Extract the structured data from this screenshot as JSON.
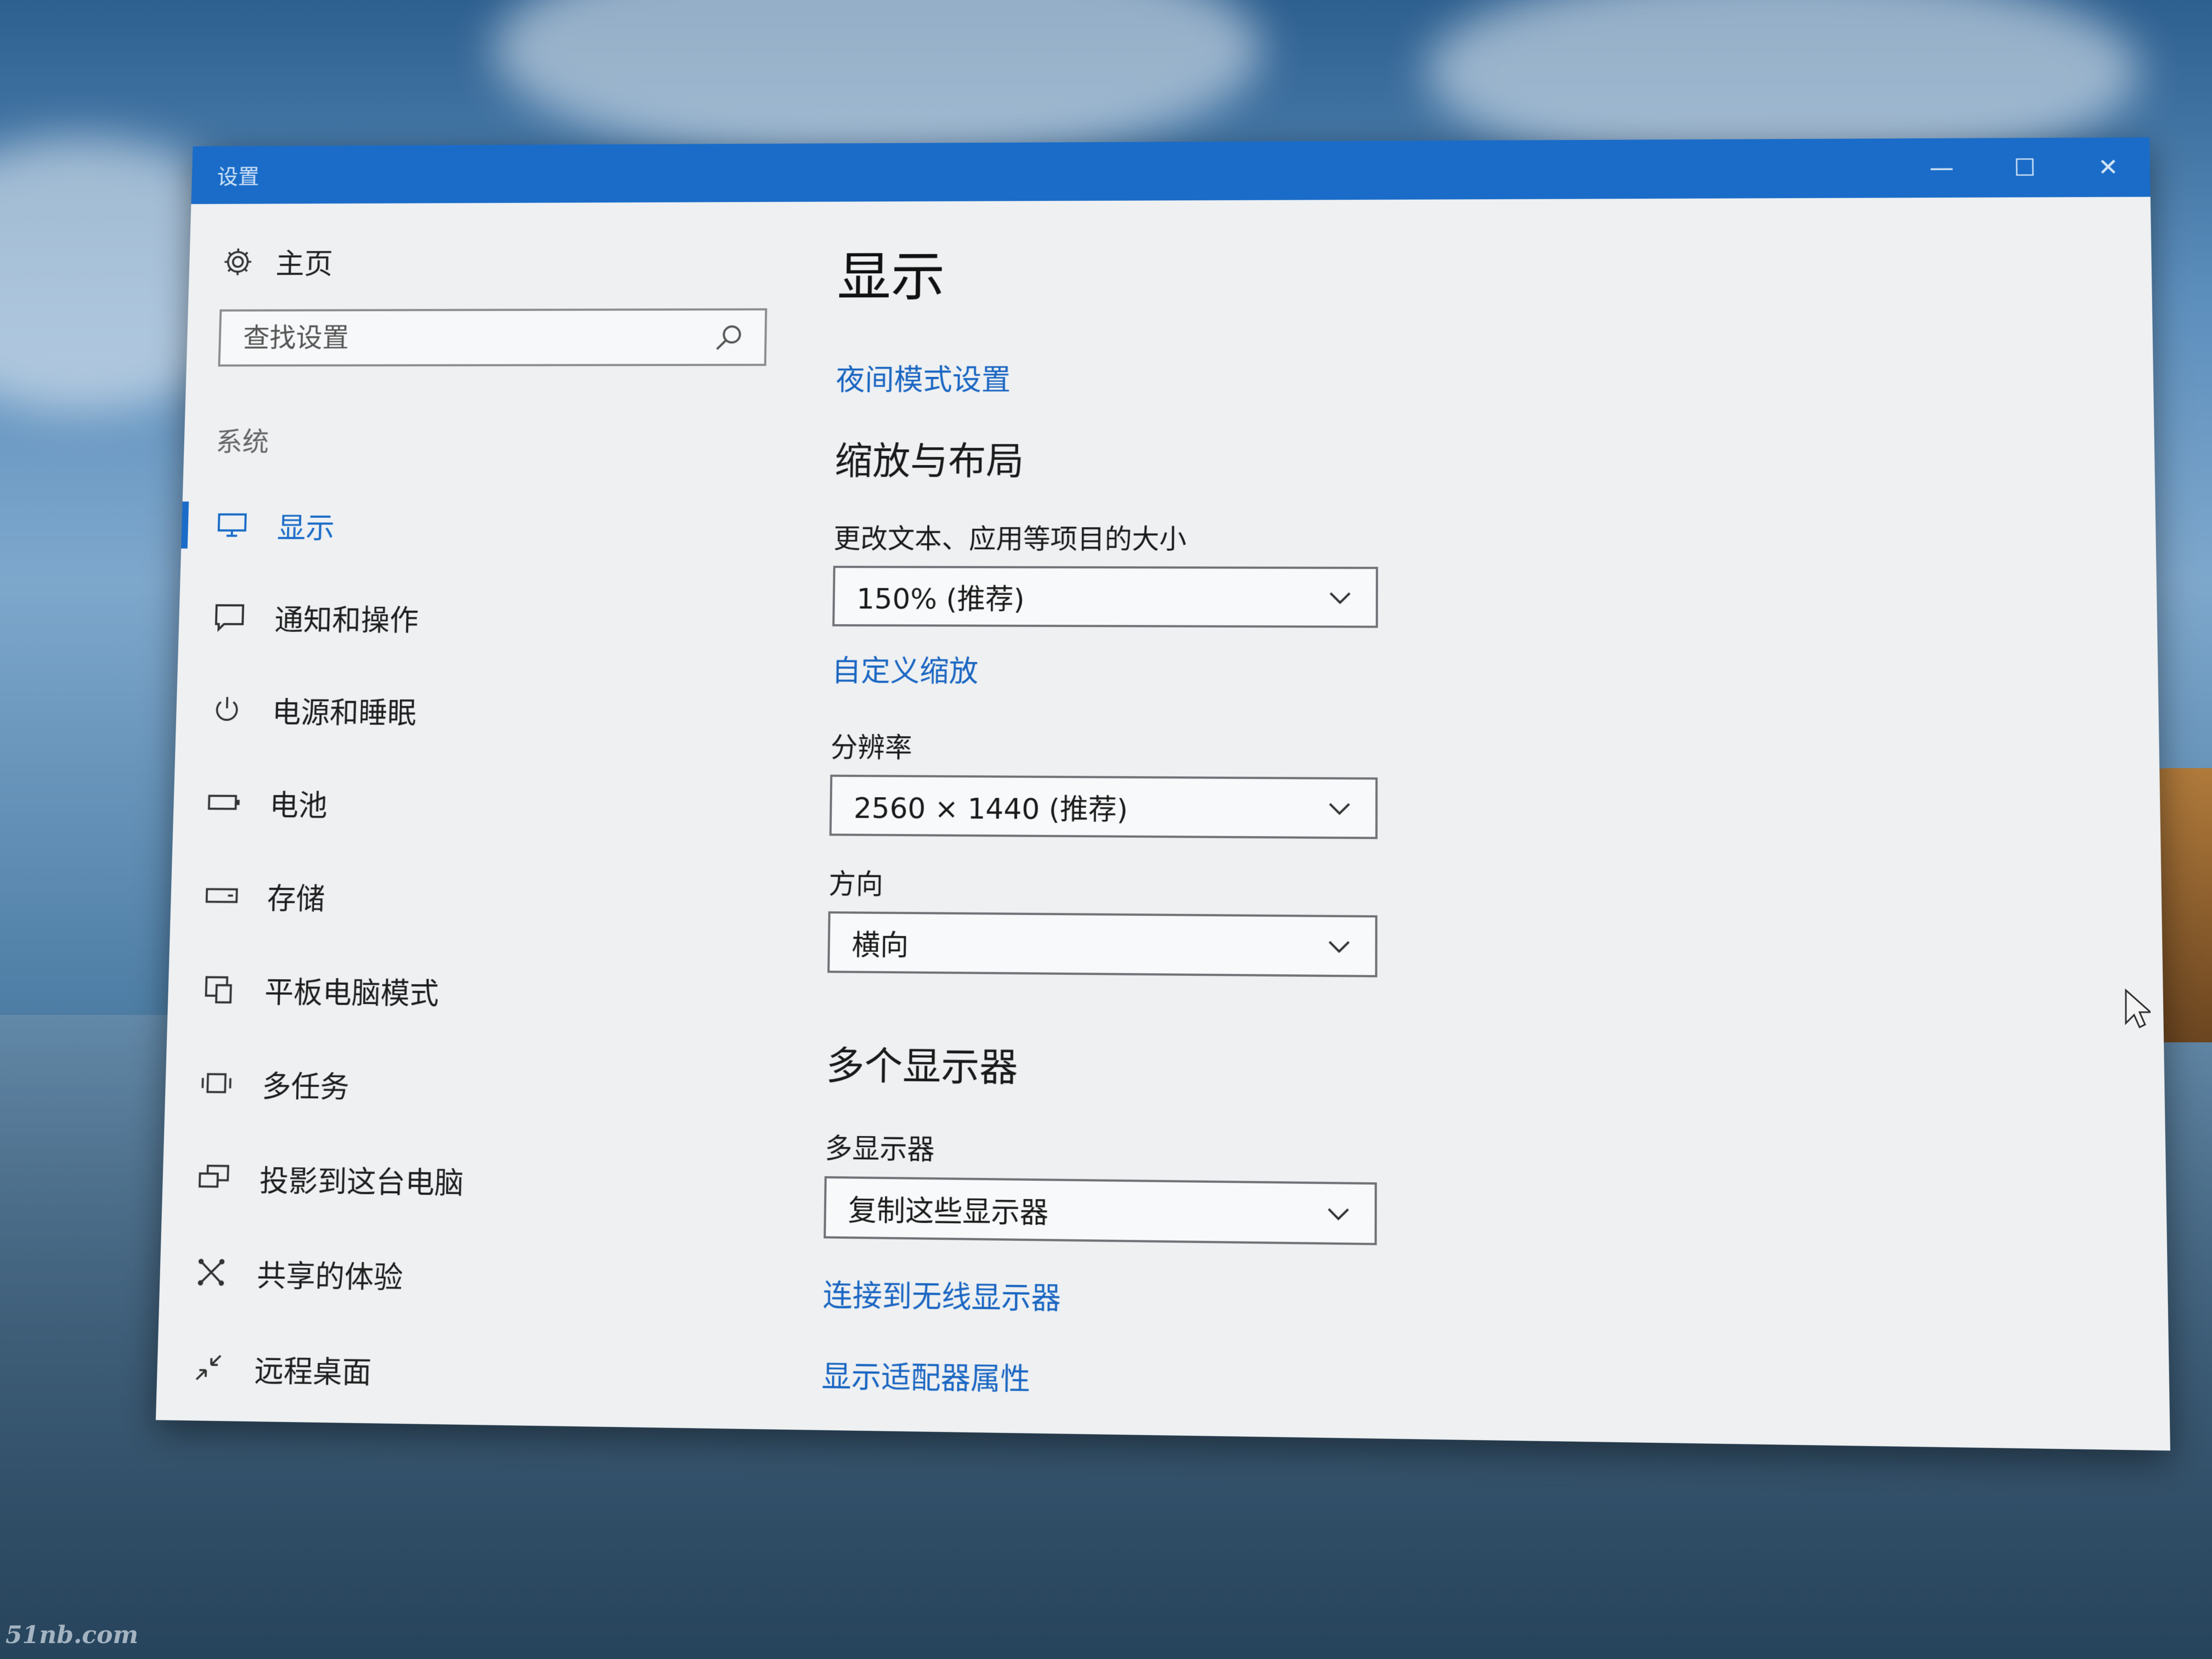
{
  "window": {
    "title": "设置",
    "controls": {
      "minimize": "—",
      "maximize": "☐",
      "close": "✕"
    }
  },
  "sidebar": {
    "home_label": "主页",
    "search": {
      "placeholder": "查找设置"
    },
    "section_label": "系统",
    "items": [
      {
        "label": "显示",
        "icon": "monitor-icon",
        "active": true
      },
      {
        "label": "通知和操作",
        "icon": "notification-icon"
      },
      {
        "label": "电源和睡眠",
        "icon": "power-icon"
      },
      {
        "label": "电池",
        "icon": "battery-icon"
      },
      {
        "label": "存储",
        "icon": "storage-icon"
      },
      {
        "label": "平板电脑模式",
        "icon": "tablet-mode-icon"
      },
      {
        "label": "多任务",
        "icon": "multitasking-icon"
      },
      {
        "label": "投影到这台电脑",
        "icon": "projection-icon"
      },
      {
        "label": "共享的体验",
        "icon": "shared-experiences-icon"
      },
      {
        "label": "远程桌面",
        "icon": "remote-desktop-icon"
      }
    ]
  },
  "main": {
    "title": "显示",
    "night_light_link": "夜间模式设置",
    "scale_section": {
      "heading": "缩放与布局",
      "size_label": "更改文本、应用等项目的大小",
      "size_value": "150% (推荐)",
      "custom_scaling_link": "自定义缩放",
      "resolution_label": "分辨率",
      "resolution_value": "2560 × 1440 (推荐)",
      "orientation_label": "方向",
      "orientation_value": "横向"
    },
    "multi_display_section": {
      "heading": "多个显示器",
      "label": "多显示器",
      "value": "复制这些显示器",
      "wireless_link": "连接到无线显示器",
      "adapter_link": "显示适配器属性"
    }
  },
  "desktop": {
    "watermark": "51nb.com"
  },
  "colors": {
    "accent": "#1a6cc8",
    "link": "#1a66c2",
    "window_bg": "#eef0f2"
  }
}
